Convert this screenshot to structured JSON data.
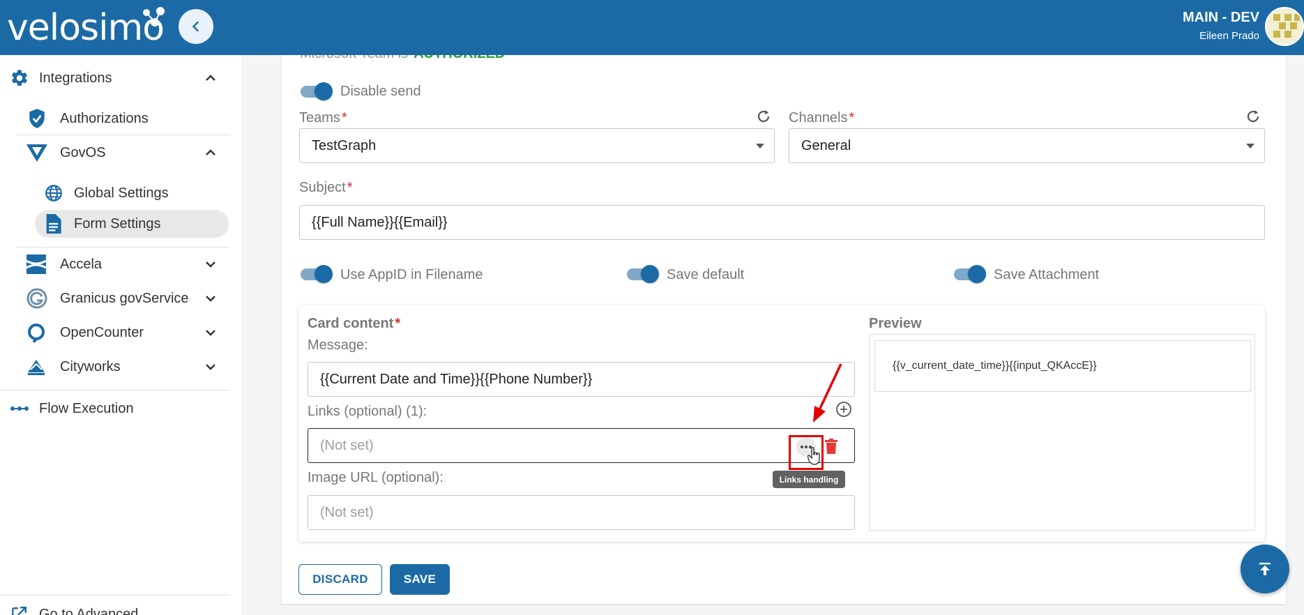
{
  "header": {
    "logo_text": "velosimo",
    "environment": "MAIN - DEV",
    "user_name": "Eileen Prado"
  },
  "sidebar": {
    "integrations": "Integrations",
    "authorizations": "Authorizations",
    "govos": "GovOS",
    "global_settings": "Global Settings",
    "form_settings": "Form Settings",
    "accela": "Accela",
    "granicus": "Granicus govService",
    "opencounter": "OpenCounter",
    "cityworks": "Cityworks",
    "flow_execution": "Flow Execution",
    "go_advanced": "Go to Advanced"
  },
  "form": {
    "auth_status_prefix": "Microsoft Team is",
    "auth_status_value": "AUTHORIZED",
    "disable_send": "Disable send",
    "teams_label": "Teams",
    "teams_value": "TestGraph",
    "channels_label": "Channels",
    "channels_value": "General",
    "subject_label": "Subject",
    "subject_value": "{{Full Name}}{{Email}}",
    "use_appid": "Use AppID in Filename",
    "save_default": "Save default",
    "save_attachment": "Save Attachment",
    "card_content_label": "Card content",
    "message_label": "Message:",
    "message_value": "{{Current Date and Time}}{{Phone Number}}",
    "links_label": "Links (optional) (1):",
    "link_placeholder": "(Not set)",
    "image_url_label": "Image URL (optional):",
    "image_url_placeholder": "(Not set)",
    "preview_label": "Preview",
    "preview_value": "{{v_current_date_time}}{{input_QKAccE}}",
    "tooltip": "Links handling",
    "discard": "DISCARD",
    "save": "SAVE"
  },
  "colors": {
    "brand": "#1b6aa5",
    "required": "#d32f2f",
    "authorized": "#2e9e3e",
    "delete": "#e53935",
    "highlight": "#e10000"
  }
}
